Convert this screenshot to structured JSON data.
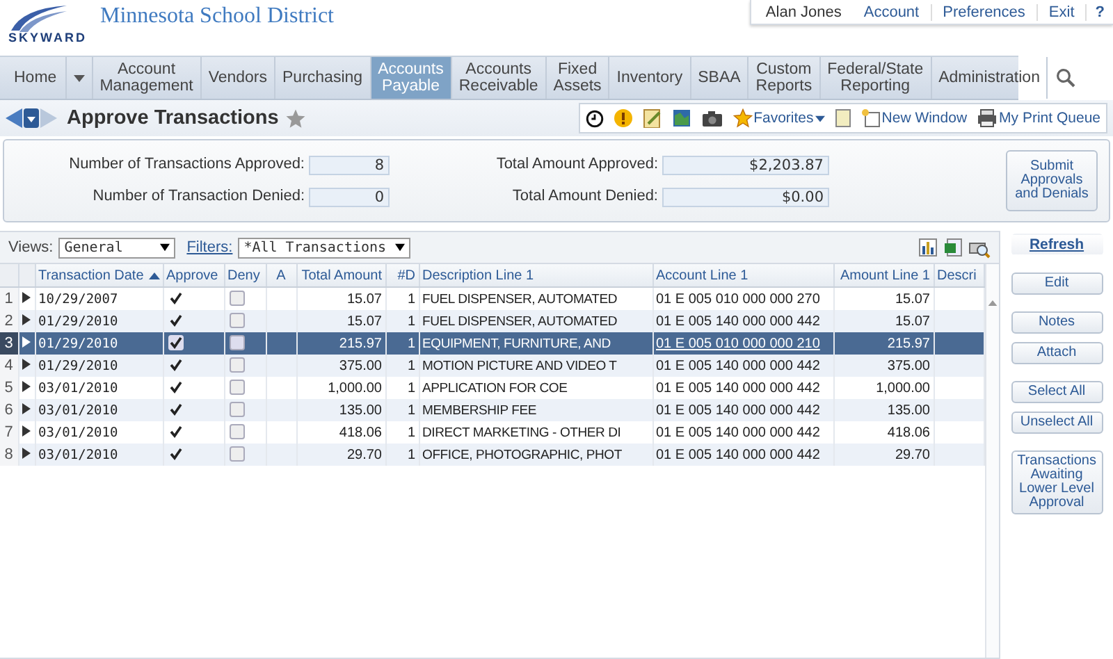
{
  "header": {
    "logo_text": "SKYWARD",
    "district": "Minnesota School District"
  },
  "user_menu": {
    "user": "Alan Jones",
    "links": [
      "Account",
      "Preferences",
      "Exit"
    ],
    "help": "?"
  },
  "nav": {
    "home": "Home",
    "items": [
      {
        "label": "Account Management",
        "selected": false
      },
      {
        "label": "Vendors",
        "selected": false
      },
      {
        "label": "Purchasing",
        "selected": false
      },
      {
        "label": "Accounts Payable",
        "selected": true
      },
      {
        "label": "Accounts Receivable",
        "selected": false
      },
      {
        "label": "Fixed Assets",
        "selected": false
      },
      {
        "label": "Inventory",
        "selected": false
      },
      {
        "label": "SBAA",
        "selected": false
      },
      {
        "label": "Custom Reports",
        "selected": false
      },
      {
        "label": "Federal/State Reporting",
        "selected": false
      },
      {
        "label": "Administration",
        "selected": false
      }
    ]
  },
  "page": {
    "title": "Approve Transactions"
  },
  "toolbar": {
    "favorites": "Favorites",
    "new_window": "New Window",
    "print_queue": "My Print Queue"
  },
  "summary": {
    "left": [
      {
        "label": "Number of Transactions Approved:",
        "value": "8"
      },
      {
        "label": "Number of Transaction Denied:",
        "value": "0"
      }
    ],
    "right": [
      {
        "label": "Total Amount Approved:",
        "value": "$2,203.87"
      },
      {
        "label": "Total Amount Denied:",
        "value": "$0.00"
      }
    ],
    "submit": "Submit Approvals and Denials"
  },
  "views": {
    "label": "Views:",
    "value": "General"
  },
  "filters": {
    "label": "Filters:",
    "value": "*All Transactions"
  },
  "table": {
    "columns": [
      "Transaction Date",
      "Approve",
      "Deny",
      "A",
      "Total Amount",
      "#D",
      "Description Line 1",
      "Account Line 1",
      "Amount Line 1",
      "Descri"
    ],
    "rows": [
      {
        "num": "1",
        "date": "10/29/2007",
        "approve": true,
        "deny": false,
        "total": "15.07",
        "d": "1",
        "desc": "FUEL DISPENSER, AUTOMATED",
        "account": "01 E 005 010 000 000 270",
        "amount": "15.07",
        "selected": false
      },
      {
        "num": "2",
        "date": "01/29/2010",
        "approve": true,
        "deny": false,
        "total": "15.07",
        "d": "1",
        "desc": "FUEL DISPENSER, AUTOMATED",
        "account": "01 E 005 140 000 000 442",
        "amount": "15.07",
        "selected": false
      },
      {
        "num": "3",
        "date": "01/29/2010",
        "approve": true,
        "deny": false,
        "total": "215.97",
        "d": "1",
        "desc": "EQUIPMENT, FURNITURE, AND",
        "account": "01 E 005 010 000 000 210",
        "amount": "215.97",
        "selected": true
      },
      {
        "num": "4",
        "date": "01/29/2010",
        "approve": true,
        "deny": false,
        "total": "375.00",
        "d": "1",
        "desc": "MOTION PICTURE AND VIDEO T",
        "account": "01 E 005 140 000 000 442",
        "amount": "375.00",
        "selected": false
      },
      {
        "num": "5",
        "date": "03/01/2010",
        "approve": true,
        "deny": false,
        "total": "1,000.00",
        "d": "1",
        "desc": "APPLICATION FOR COE",
        "account": "01 E 005 140 000 000 442",
        "amount": "1,000.00",
        "selected": false
      },
      {
        "num": "6",
        "date": "03/01/2010",
        "approve": true,
        "deny": false,
        "total": "135.00",
        "d": "1",
        "desc": "MEMBERSHIP FEE",
        "account": "01 E 005 140 000 000 442",
        "amount": "135.00",
        "selected": false
      },
      {
        "num": "7",
        "date": "03/01/2010",
        "approve": true,
        "deny": false,
        "total": "418.06",
        "d": "1",
        "desc": "DIRECT MARKETING - OTHER DI",
        "account": "01 E 005 140 000 000 442",
        "amount": "418.06",
        "selected": false
      },
      {
        "num": "8",
        "date": "03/01/2010",
        "approve": true,
        "deny": false,
        "total": "29.70",
        "d": "1",
        "desc": "OFFICE, PHOTOGRAPHIC, PHOT",
        "account": "01 E 005 140 000 000 442",
        "amount": "29.70",
        "selected": false
      }
    ]
  },
  "side_groups": [
    [
      {
        "label": "Refresh",
        "kind": "link"
      }
    ],
    [
      {
        "label": "Edit",
        "kind": "button"
      }
    ],
    [
      {
        "label": "Notes",
        "kind": "button"
      },
      {
        "label": "Attach",
        "kind": "button"
      }
    ],
    [
      {
        "label": "Select All",
        "kind": "button"
      },
      {
        "label": "Unselect All",
        "kind": "button"
      }
    ],
    [
      {
        "label": "Transactions Awaiting Lower Level Approval",
        "kind": "button"
      }
    ]
  ]
}
